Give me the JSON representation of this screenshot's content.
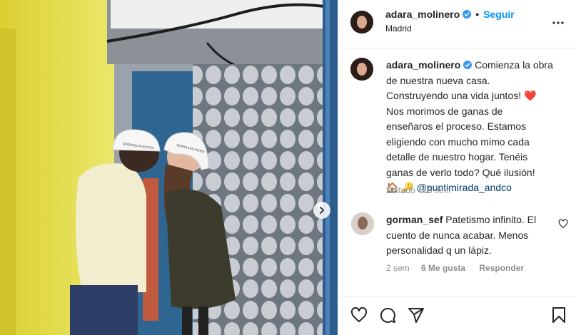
{
  "post": {
    "username": "adara_molinero",
    "follow_label": "Seguir",
    "location": "Madrid",
    "caption_lines": [
      "Comienza la obra",
      "de nuestra nueva casa.",
      "Construyendo una vida juntos! ❤️",
      "Nos morimos de ganas de",
      "enseñaros el proceso. Estamos",
      "eligiendo con mucho mimo cada",
      "detalle de nuestro hogar. Tenéis",
      "ganas de verlo todo? Qué ilusión!"
    ],
    "caption_emojis": "🏠 🔑",
    "caption_mention": "@puntimirada_andco",
    "edited_label": "Editado",
    "edited_time": "15 sem",
    "photo_helmet_left_text": "RODRIGO FUERTES",
    "photo_helmet_right_text": "ADARA MOLINERO"
  },
  "comment": {
    "username": "gorman_sef",
    "text": "Patetismo infinito. El cuento de nunca acabar. Menos personalidad q un lápiz.",
    "time": "2 sem",
    "likes": "6 Me gusta",
    "reply_label": "Responder"
  },
  "icons": {
    "verified": "verified-badge-icon",
    "more": "more-options-icon",
    "like": "heart-icon",
    "comment": "comment-icon",
    "share": "share-icon",
    "save": "bookmark-icon",
    "next": "chevron-right-icon"
  },
  "colors": {
    "accent": "#0095f6",
    "verified": "#3897f0",
    "mention": "#00376b",
    "muted": "#8e8e8e"
  }
}
